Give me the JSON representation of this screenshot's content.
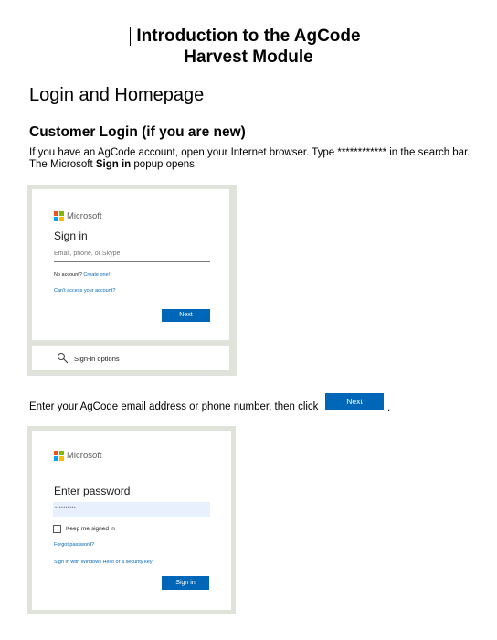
{
  "title": {
    "line1": "Introduction to the AgCode",
    "line2": "Harvest Module"
  },
  "section_heading": "Login and Homepage",
  "subsection_heading": "Customer Login (if you are new)",
  "intro": {
    "part1": "If you have an AgCode account, open your Internet browser. Type ************ in the search bar. The Microsoft ",
    "bold": "Sign in",
    "part2": " popup opens."
  },
  "signin_screenshot": {
    "brand": "Microsoft",
    "heading": "Sign in",
    "placeholder": "Email, phone, or Skype",
    "no_account": "No account?",
    "create_one": "Create one!",
    "cant_access": "Can't access your account?",
    "next_button": "Next",
    "signin_options": "Sign-in options"
  },
  "instruction": {
    "text": "Enter your AgCode email address or phone number, then click",
    "button": "Next",
    "end": "."
  },
  "password_screenshot": {
    "brand": "Microsoft",
    "heading": "Enter password",
    "password_mask": "••••••••••",
    "keep_signed_in": "Keep me signed in",
    "forgot": "Forgot password?",
    "windows_hello": "Sign in with Windows Hello or a security key",
    "signin_button": "Sign in"
  },
  "colors": {
    "accent": "#0067b8",
    "screenshot_bg": "#dfe3da"
  }
}
